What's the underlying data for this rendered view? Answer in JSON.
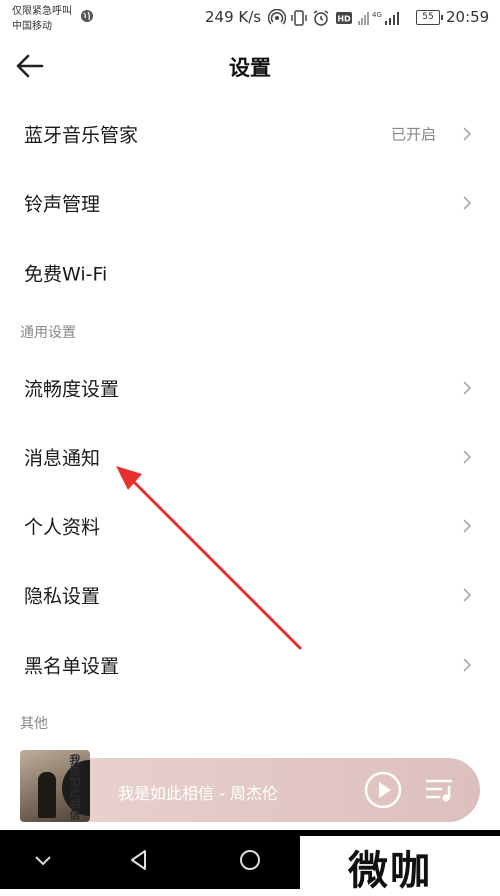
{
  "status_bar": {
    "carrier_line1": "仅限紧急呼叫",
    "carrier_line2": "中国移动",
    "network_speed": "249 K/s",
    "battery": "55",
    "time": "20:59"
  },
  "header": {
    "title": "设置"
  },
  "settings": {
    "bluetooth": {
      "label": "蓝牙音乐管家",
      "value": "已开启"
    },
    "ringtone": {
      "label": "铃声管理"
    },
    "wifi": {
      "label": "免费Wi-Fi"
    },
    "general_header": "通用设置",
    "fluency": {
      "label": "流畅度设置"
    },
    "notification": {
      "label": "消息通知"
    },
    "profile": {
      "label": "个人资料"
    },
    "privacy": {
      "label": "隐私设置"
    },
    "blacklist": {
      "label": "黑名单设置"
    },
    "other_header": "其他"
  },
  "player": {
    "song": "我是如此相信 - 周杰伦",
    "album_art_text": "我是如此相信"
  },
  "watermark": {
    "text": "微咖"
  },
  "colors": {
    "annotation_arrow": "#e8312e",
    "player_background": "#e6cdca"
  },
  "icons": [
    "globe-icon",
    "hotspot-icon",
    "vibrate-icon",
    "alarm-icon",
    "hd-icon",
    "signal-icon",
    "back-arrow-icon",
    "chevron-right-icon",
    "play-icon",
    "playlist-icon",
    "nav-down-icon",
    "nav-back-icon",
    "nav-home-icon"
  ]
}
